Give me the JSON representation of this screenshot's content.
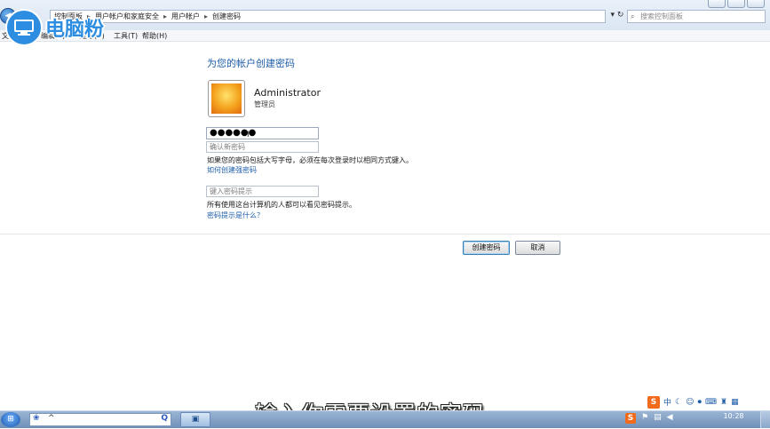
{
  "window": {
    "breadcrumb": [
      "控制面板",
      "用户帐户和家庭安全",
      "用户帐户",
      "创建密码"
    ],
    "search_placeholder": "搜索控制面板",
    "menu": [
      "文件(F)",
      "编辑(E)",
      "查看(V)",
      "工具(T)",
      "帮助(H)"
    ]
  },
  "watermark": {
    "text": "电脑粉"
  },
  "page": {
    "heading": "为您的帐户创建密码",
    "user": {
      "name": "Administrator",
      "role": "管理员"
    },
    "password_value": "●●●●●●",
    "confirm_placeholder": "确认新密码",
    "caps_note": "如果您的密码包括大写字母，必须在每次登录时以相同方式键入。",
    "strong_password_link": "如何创建强密码",
    "hint_placeholder": "键入密码提示",
    "hint_note": "所有使用这台计算机的人都可以看见密码提示。",
    "hint_help_link": "密码提示是什么？",
    "create_button": "创建密码",
    "cancel_button": "取消"
  },
  "subtitle": "输入你需要设置的密码",
  "ime_bar": {
    "brand": "S",
    "mode": "中"
  },
  "taskbar": {
    "clock": "10:28"
  },
  "colors": {
    "link": "#1e5ea8",
    "accent": "#2d8de0",
    "ime": "#f26a1b"
  }
}
